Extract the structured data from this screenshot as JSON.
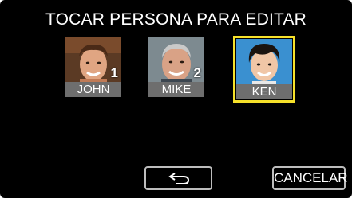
{
  "title": "TOCAR PERSONA PARA EDITAR",
  "people": [
    {
      "name": "JOHN",
      "number": "1",
      "selected": false
    },
    {
      "name": "MIKE",
      "number": "2",
      "selected": false
    },
    {
      "name": "KEN",
      "number": "",
      "selected": true
    }
  ],
  "buttons": {
    "back_icon": "return-arrow-icon",
    "cancel_label": "CANCELAR"
  },
  "colors": {
    "background": "#000000",
    "selection_border": "#f6e12a",
    "name_bar": "#6e6e6e",
    "button_border": "#bdbdbd"
  }
}
